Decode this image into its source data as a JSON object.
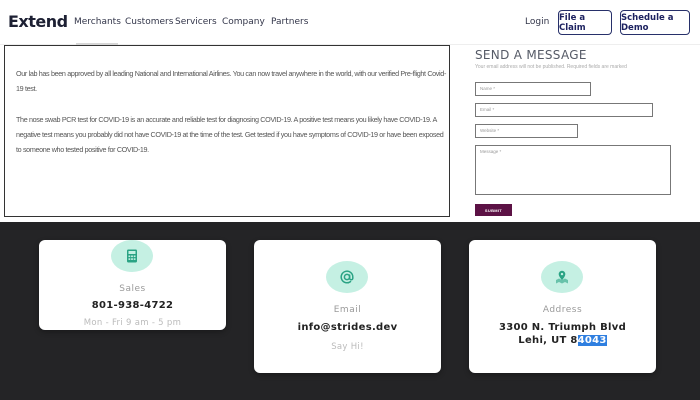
{
  "nav": {
    "logo": "Extend",
    "links": [
      "Merchants",
      "Customers",
      "Servicers",
      "Company",
      "Partners"
    ],
    "login": "Login",
    "file_claim": "File a Claim",
    "schedule_demo": "Schedule a Demo"
  },
  "content": {
    "p1": "Our lab has been approved by all leading National and International Airlines. You can now travel anywhere in the world, with our verified Pre-flight Covid-19 test.",
    "p2": "The nose swab PCR test for COVID-19 is an accurate and reliable test for diagnosing COVID-19. A positive test means you likely have COVID-19. A negative test means you probably did not have COVID-19 at the time of the test. Get tested if you have symptoms of COVID-19 or have been exposed to someone who tested positive for COVID-19."
  },
  "form": {
    "title": "SEND A MESSAGE",
    "note": "Your email address will not be published. Required fields are marked",
    "name_placeholder": "Name *",
    "email_placeholder": "Email *",
    "website_placeholder": "Website *",
    "message_placeholder": "Message *",
    "submit": "SUBMIT"
  },
  "contacts": {
    "sales": {
      "label": "Sales",
      "value": "801-938-4722",
      "sub": "Mon - Fri 9 am - 5 pm",
      "icon": "calculator-icon"
    },
    "email": {
      "label": "Email",
      "value": "info@strides.dev",
      "sub": "Say Hi!",
      "icon": "at-icon"
    },
    "address": {
      "label": "Address",
      "line1": "3300 N. Triumph Blvd",
      "line2_prefix": "Lehi, UT 8",
      "line2_selected": "4043",
      "icon": "map-pin-icon"
    }
  },
  "colors": {
    "accent": "#1d2260",
    "submit": "#5c1245",
    "dark_bg": "#242426",
    "icon_bg": "#c5f0e3",
    "icon_fg": "#2aa384",
    "selection": "#2f7fe0"
  }
}
